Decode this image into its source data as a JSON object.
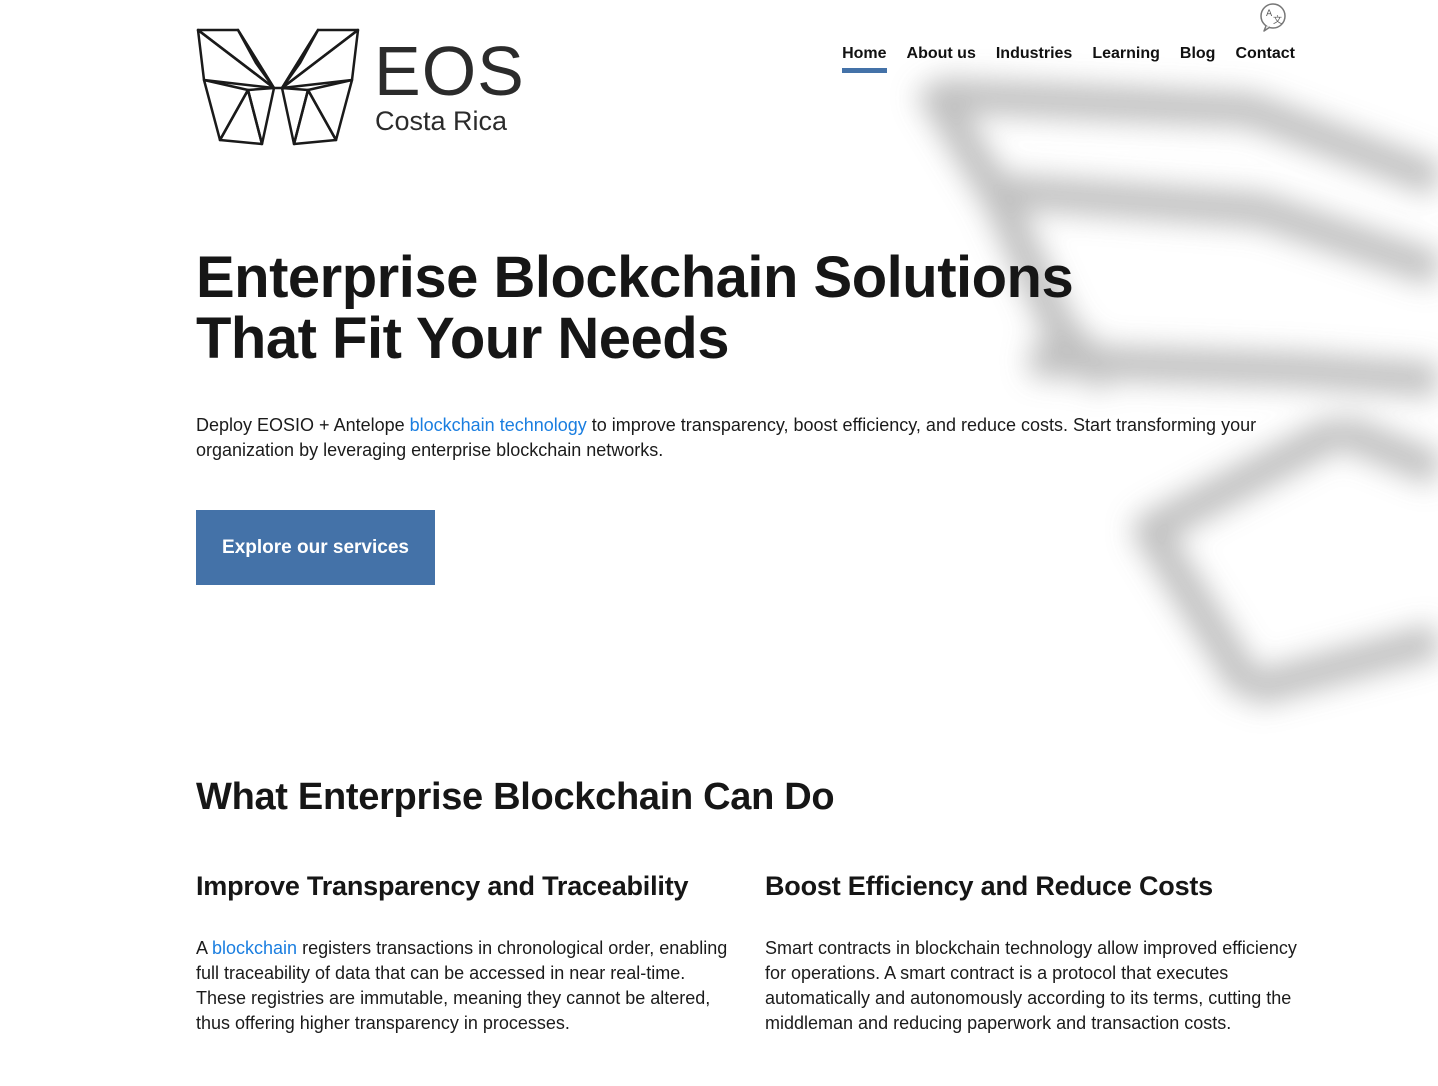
{
  "brand": {
    "title": "EOS",
    "subtitle": "Costa Rica"
  },
  "nav": {
    "items": [
      {
        "label": "Home",
        "active": true
      },
      {
        "label": "About us",
        "active": false
      },
      {
        "label": "Industries",
        "active": false
      },
      {
        "label": "Learning",
        "active": false
      },
      {
        "label": "Blog",
        "active": false
      },
      {
        "label": "Contact",
        "active": false
      }
    ],
    "translate_icon": "translate-icon"
  },
  "hero": {
    "title_line1": "Enterprise Blockchain Solutions",
    "title_line2": "That Fit Your Needs",
    "text_before": "Deploy EOSIO + Antelope ",
    "text_link": "blockchain technology",
    "text_after": " to improve transparency, boost efficiency, and reduce costs. Start transforming your organization by leveraging enterprise blockchain networks.",
    "cta_label": "Explore our services"
  },
  "section": {
    "title": "What Enterprise Blockchain Can Do",
    "left": {
      "heading": "Improve Transparency and Traceability",
      "text_before": "A ",
      "text_link": "blockchain",
      "text_after": " registers transactions in chronological order, enabling full traceability of data that can be accessed in near real-time. These registries are immutable, meaning they cannot be altered, thus offering higher transparency in processes."
    },
    "right": {
      "heading": "Boost Efficiency and Reduce Costs",
      "text": "Smart contracts in blockchain technology allow improved efficiency for operations. A smart contract is a protocol that executes automatically and autonomously according to its terms, cutting the middleman and reducing paperwork and transaction costs."
    }
  },
  "colors": {
    "accent": "#4472a8",
    "link": "#1a7ee0",
    "text": "#161616"
  }
}
